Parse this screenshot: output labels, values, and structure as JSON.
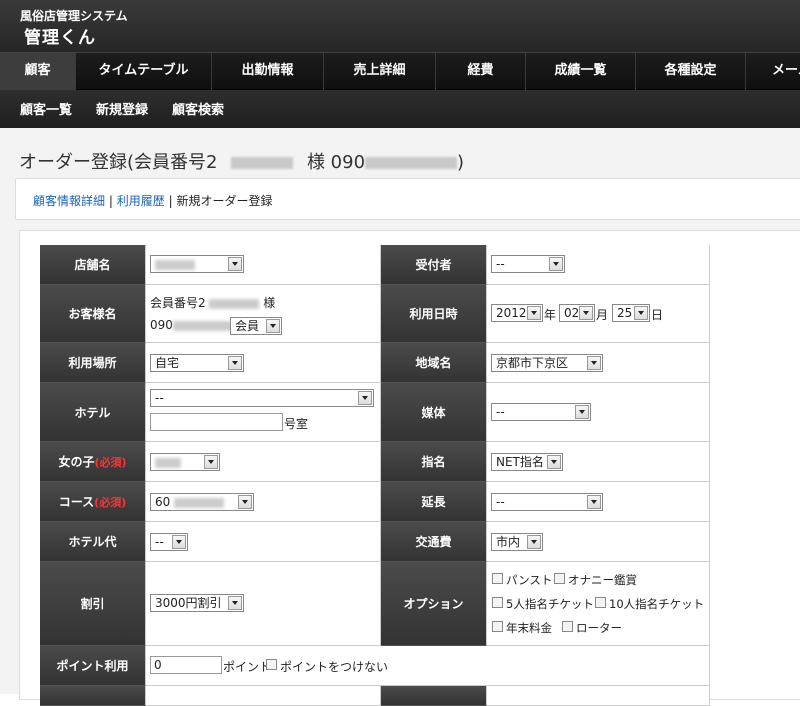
{
  "header": {
    "system_name": "風俗店管理システム",
    "app_name": "管理くん"
  },
  "nav": {
    "tabs": [
      "顧客",
      "タイムテーブル",
      "出勤情報",
      "売上詳細",
      "経費",
      "成績一覧",
      "各種設定",
      "メール"
    ]
  },
  "subnav": {
    "items": [
      "顧客一覧",
      "新規登録",
      "顧客検索"
    ]
  },
  "page": {
    "title_prefix": "オーダー登録(会員番号2",
    "title_mid": "様 090",
    "title_suffix": ")"
  },
  "breadcrumb": {
    "link1": "顧客情報詳細",
    "sep": "|",
    "link2": "利用履歴",
    "current": "新規オーダー登録"
  },
  "form": {
    "store_label": "店舗名",
    "receiver_label": "受付者",
    "receiver_value": "--",
    "customer_label": "お客様名",
    "customer_line1_prefix": "会員番号2",
    "customer_line1_suffix": "様",
    "customer_line2_prefix": "090",
    "member_type": "会員",
    "usage_datetime_label": "利用日時",
    "year": "2012",
    "year_unit": "年",
    "month": "02",
    "month_unit": "月",
    "day": "25",
    "day_unit": "日",
    "place_label": "利用場所",
    "place_value": "自宅",
    "area_label": "地域名",
    "area_value": "京都市下京区",
    "hotel_label": "ホテル",
    "hotel_value": "--",
    "room_unit": "号室",
    "media_label": "媒体",
    "media_value": "--",
    "girl_label": "女の子",
    "required_mark": "(必須)",
    "nomination_label": "指名",
    "nomination_value": "NET指名",
    "course_label": "コース",
    "course_value": "60",
    "extension_label": "延長",
    "extension_value": "--",
    "hotel_fee_label": "ホテル代",
    "hotel_fee_value": "--",
    "transport_label": "交通費",
    "transport_value": "市内",
    "discount_label": "割引",
    "discount_value": "3000円割引",
    "options_label": "オプション",
    "options": [
      "パンスト",
      "オナニー鑑賞",
      "5人指名チケット",
      "10人指名チケット",
      "年末料金",
      "ローター"
    ],
    "point_label": "ポイント利用",
    "point_value": "0",
    "point_unit": "ポイント",
    "no_point_label": "ポイントをつけない"
  }
}
